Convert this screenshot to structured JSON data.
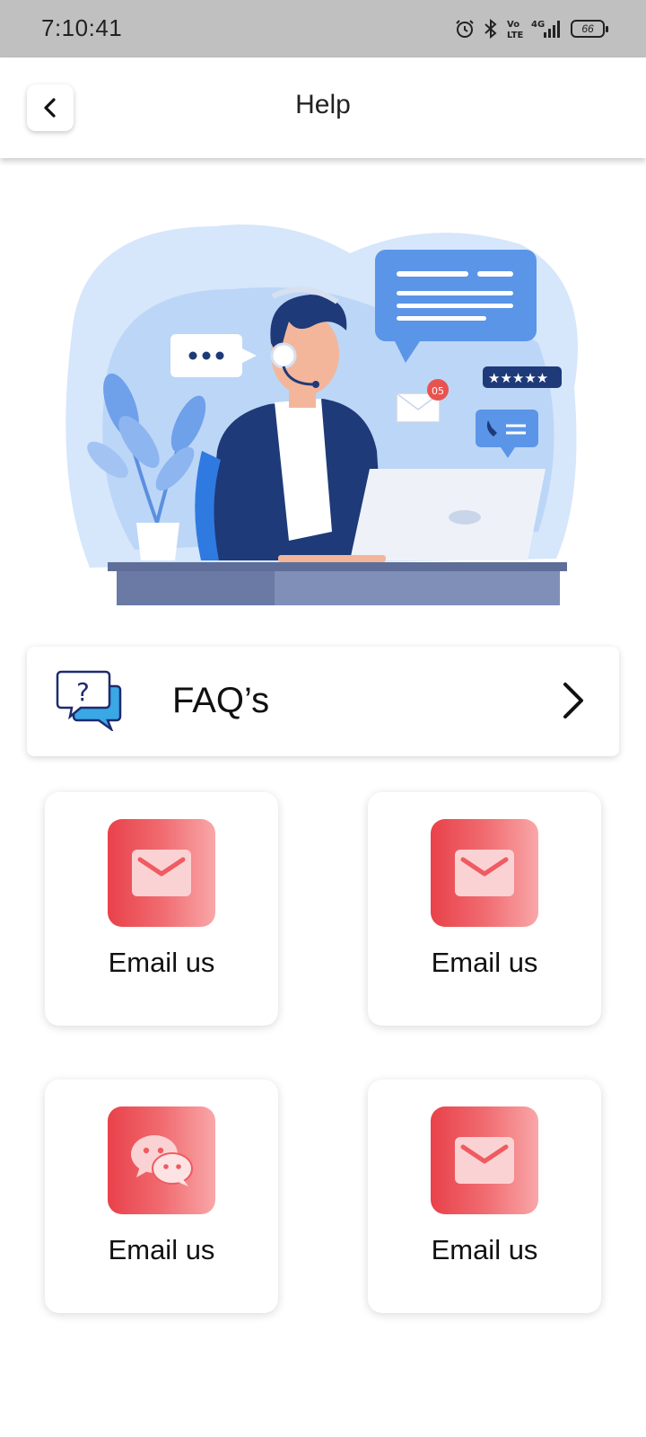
{
  "status_bar": {
    "time": "7:10:41",
    "battery": "66",
    "icons": [
      "alarm-icon",
      "bluetooth-icon",
      "volte-icon",
      "signal-4g-icon",
      "battery-icon"
    ]
  },
  "header": {
    "title": "Help",
    "back_icon": "chevron-left-icon"
  },
  "hero": {
    "illustration": "customer-support-agent-illustration",
    "badge_count": "05"
  },
  "faq": {
    "label": "FAQ’s",
    "icon": "faq-chat-bubbles-icon",
    "chevron_icon": "chevron-right-icon"
  },
  "contact_cards": [
    {
      "label": "Email us",
      "icon": "mail-icon"
    },
    {
      "label": "Email us",
      "icon": "mail-icon"
    },
    {
      "label": "Email us",
      "icon": "chat-icon"
    },
    {
      "label": "Email us",
      "icon": "mail-icon"
    }
  ],
  "colors": {
    "status_bar": "#c0c0c0",
    "icon_tile_start": "#e9414a",
    "icon_tile_end": "#f9a7a8",
    "illustration_blue": "#1e3a78"
  }
}
